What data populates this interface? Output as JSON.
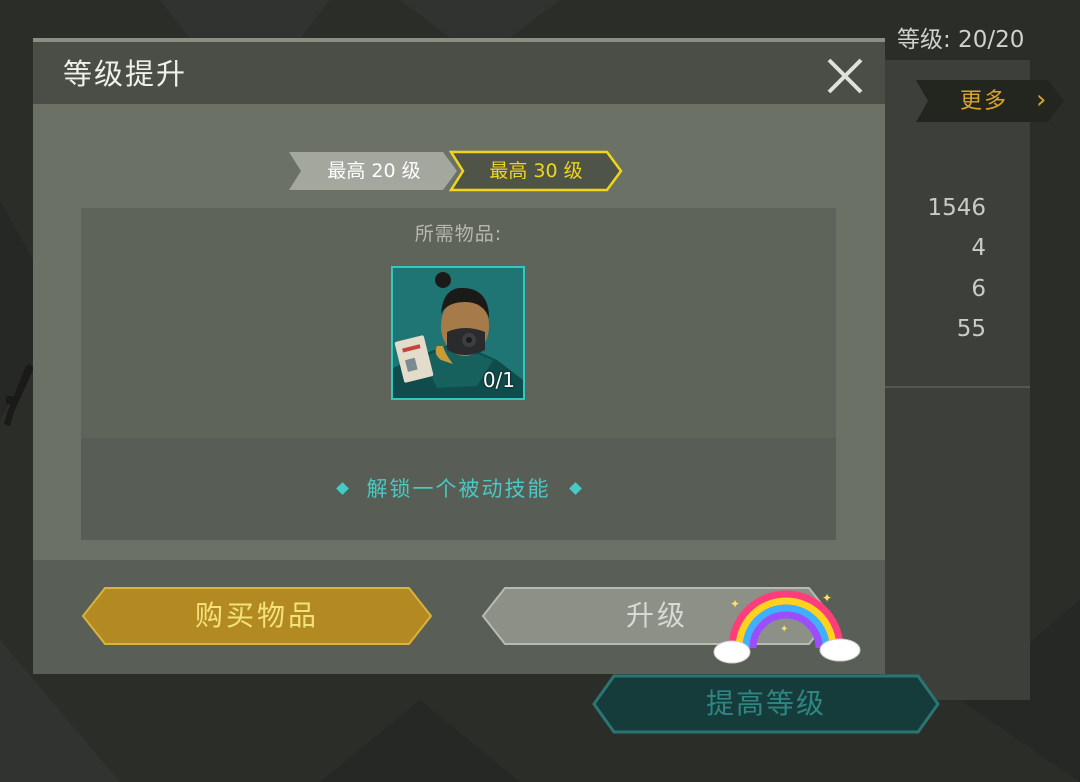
{
  "background": {
    "level_text": "等级: 20/20",
    "more_label": "更多",
    "stats": [
      "1546",
      "4",
      "6",
      "55"
    ],
    "raise_level_button": "提高等级"
  },
  "modal": {
    "title": "等级提升",
    "tabs": [
      {
        "label": "最高 20 级",
        "active": false
      },
      {
        "label": "最高 30 级",
        "active": true
      }
    ],
    "required_items_label": "所需物品:",
    "item": {
      "count": "0/1",
      "icon": "masked-hero-card-icon"
    },
    "unlock_text": "解锁一个被动技能",
    "buy_button": "购买物品",
    "upgrade_button": "升级"
  },
  "colors": {
    "accent_teal": "#48c9c5",
    "accent_gold": "#d7a52c",
    "active_tab_yellow": "#f0d51c",
    "buy_button": "#b38a21"
  }
}
